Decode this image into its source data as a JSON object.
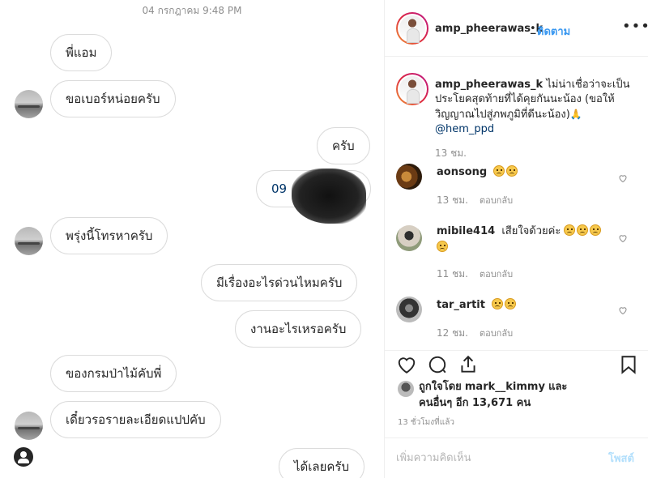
{
  "chat": {
    "date": "04 กรกฎาคม 9:48 PM",
    "messages": [
      {
        "text": "พี่แอม",
        "side": "in"
      },
      {
        "text": "ขอเบอร์หน่อยครับ",
        "side": "in"
      },
      {
        "text": "ครับ",
        "side": "out"
      },
      {
        "text": "09",
        "side": "out",
        "redacted": true
      },
      {
        "text": "พรุ่งนี้โทรหาครับ",
        "side": "in"
      },
      {
        "text": "มีเรื่องอะไรด่วนไหมครับ",
        "side": "out"
      },
      {
        "text": "งานอะไรเหรอครับ",
        "side": "out"
      },
      {
        "text": "ของกรมป่าไม้คับพี่",
        "side": "in"
      },
      {
        "text": "เดี๋ยวรอรายละเอียดแปปคับ",
        "side": "in"
      },
      {
        "text": "ได้เลยครับ",
        "side": "out"
      }
    ]
  },
  "post": {
    "username": "amp_pheerawas_k",
    "dot": "•",
    "follow_label": "ติดตาม",
    "more_icon": "more-horizontal-icon",
    "caption": {
      "username": "amp_pheerawas_k",
      "text": "ไม่น่าเชื่อว่าจะเป็นประโยคสุดท้ายที่ได้คุยกันนะน้อง (ขอให้วิญญาณไปสู่ภพภูมิที่ดีนะน้อง)",
      "mention": "@hem_ppd",
      "time": "13 ชม."
    },
    "comments": [
      {
        "username": "aonsong",
        "text": "",
        "emoji_count": 2,
        "time": "13 ชม.",
        "reply": "ตอบกลับ"
      },
      {
        "username": "mibile414",
        "text": "เสียใจด้วยค่ะ",
        "emoji_count": 4,
        "time": "11 ชม.",
        "reply": "ตอบกลับ"
      },
      {
        "username": "tar_artit",
        "text": "",
        "emoji_count": 2,
        "time": "12 ชม.",
        "reply": "ตอบกลับ"
      }
    ],
    "likes": {
      "prefix": "ถูกใจโดย",
      "user": "mark__kimmy",
      "and": "และ",
      "others": "คนอื่นๆ อีก 13,671 คน"
    },
    "time_ago": "13 ชั่วโมงที่แล้ว",
    "comment_placeholder": "เพิ่มความคิดเห็น",
    "post_label": "โพสต์"
  },
  "colors": {
    "accent": "#3897f0",
    "border": "#dbdbdb",
    "muted": "#8e8e8e"
  }
}
